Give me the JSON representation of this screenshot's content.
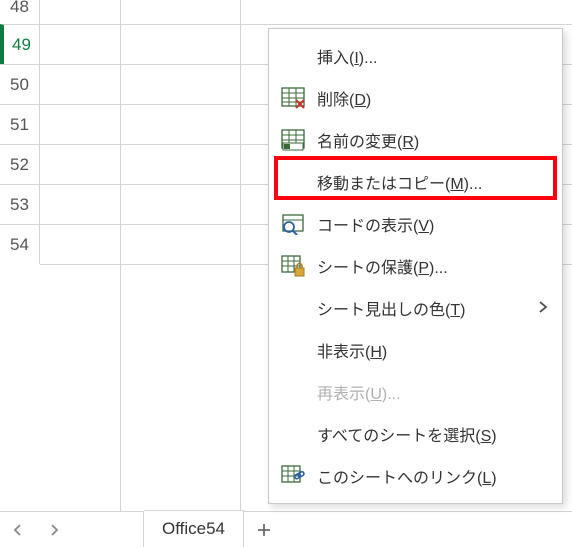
{
  "rows": [
    {
      "num": "48",
      "selected": false
    },
    {
      "num": "49",
      "selected": true
    },
    {
      "num": "50",
      "selected": false
    },
    {
      "num": "51",
      "selected": false
    },
    {
      "num": "52",
      "selected": false
    },
    {
      "num": "53",
      "selected": false
    },
    {
      "num": "54",
      "selected": false
    }
  ],
  "sheet_tab": "Office54",
  "menu": {
    "insert": {
      "text": "挿入(",
      "key": "I",
      "suffix": ")..."
    },
    "delete": {
      "text": "削除(",
      "key": "D",
      "suffix": ")"
    },
    "rename": {
      "text": "名前の変更(",
      "key": "R",
      "suffix": ")"
    },
    "move_copy": {
      "text": "移動またはコピー(",
      "key": "M",
      "suffix": ")..."
    },
    "view_code": {
      "text": "コードの表示(",
      "key": "V",
      "suffix": ")"
    },
    "protect": {
      "text": "シートの保護(",
      "key": "P",
      "suffix": ")..."
    },
    "tab_color": {
      "text": "シート見出しの色(",
      "key": "T",
      "suffix": ")"
    },
    "hide": {
      "text": "非表示(",
      "key": "H",
      "suffix": ")"
    },
    "unhide": {
      "text": "再表示(",
      "key": "U",
      "suffix": ")..."
    },
    "select_all": {
      "text": "すべてのシートを選択(",
      "key": "S",
      "suffix": ")"
    },
    "link": {
      "text": "このシートへのリンク(",
      "key": "L",
      "suffix": ")"
    }
  }
}
